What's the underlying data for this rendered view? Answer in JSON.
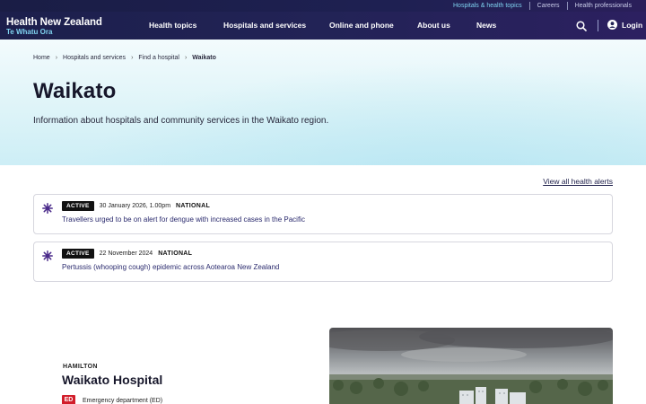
{
  "utility_links": [
    {
      "label": "Hospitals & health topics",
      "active": true
    },
    {
      "label": "Careers",
      "active": false
    },
    {
      "label": "Health professionals",
      "active": false
    }
  ],
  "logo": {
    "line1": "Health New Zealand",
    "line2": "Te Whatu Ora"
  },
  "nav": {
    "items": [
      "Health topics",
      "Hospitals and services",
      "Online and phone",
      "About us",
      "News"
    ],
    "search_icon": "search-icon",
    "login_label": "Login"
  },
  "breadcrumb": {
    "items": [
      "Home",
      "Hospitals and services",
      "Find a hospital"
    ],
    "current": "Waikato"
  },
  "hero": {
    "title": "Waikato",
    "description": "Information about hospitals and community services in the Waikato region."
  },
  "alerts": {
    "view_all_label": "View all health alerts",
    "items": [
      {
        "status": "ACTIVE",
        "date": "30 January 2026, 1.00pm",
        "scope": "NATIONAL",
        "text": "Travellers urged to be on alert for dengue with increased cases in the Pacific"
      },
      {
        "status": "ACTIVE",
        "date": "22 November 2024",
        "scope": "NATIONAL",
        "text": "Pertussis (whooping cough) epidemic across Aotearoa New Zealand"
      }
    ]
  },
  "hospital": {
    "location": "HAMILTON",
    "name": "Waikato Hospital",
    "ed_badge": "ED",
    "ed_label": "Emergency department (ED)"
  },
  "colors": {
    "nav_bg": "#1e2052",
    "accent_cyan": "#7fd3f0",
    "alert_icon": "#4a2a8a",
    "ed_red": "#d21e2b"
  }
}
